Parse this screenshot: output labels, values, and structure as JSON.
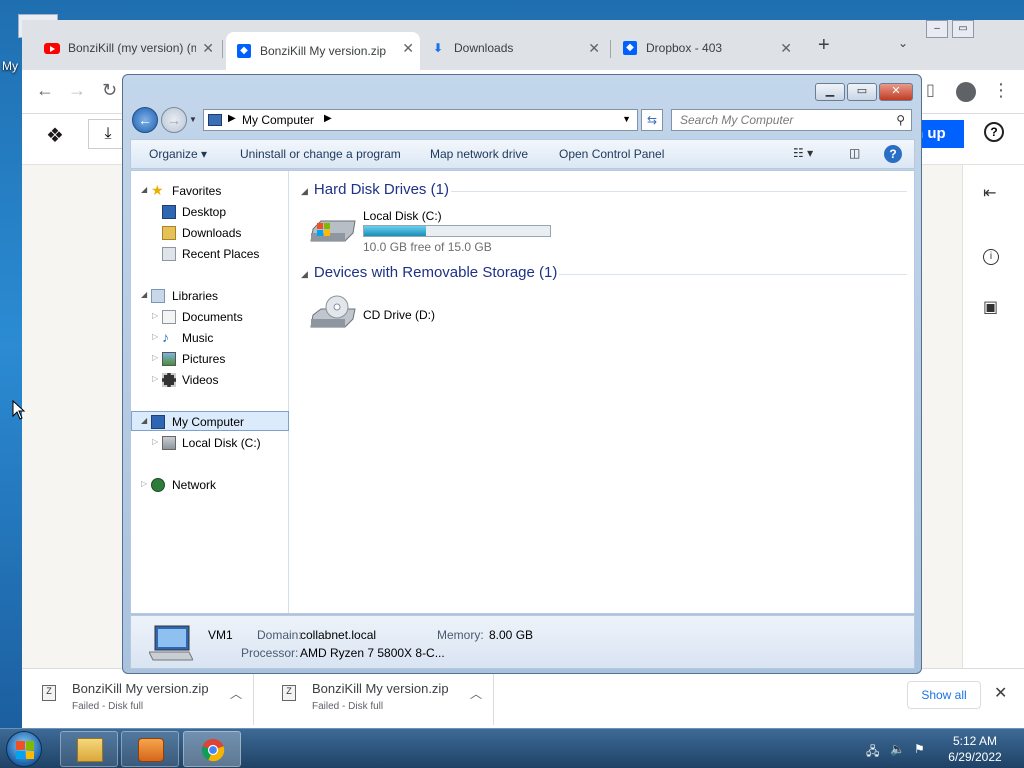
{
  "desktop": {
    "icon_label": "My"
  },
  "browser": {
    "tabs": [
      {
        "title": "BonziKill (my version) (m",
        "icon": "youtube-icon"
      },
      {
        "title": "BonziKill My version.zip",
        "icon": "dropbox-icon"
      },
      {
        "title": "Downloads",
        "icon": "download-icon"
      },
      {
        "title": "Dropbox - 403",
        "icon": "dropbox-icon"
      }
    ],
    "close_glyph": "✕",
    "new_tab_glyph": "+",
    "page": {
      "signup_label": "n up",
      "help_glyph": "?"
    },
    "downloads": [
      {
        "name": "BonziKill My version.zip",
        "status": "Failed - Disk full"
      },
      {
        "name": "BonziKill My version.zip",
        "status": "Failed - Disk full"
      }
    ],
    "show_all_label": "Show all"
  },
  "explorer": {
    "breadcrumb": "My Computer",
    "search_placeholder": "Search My Computer",
    "commands": {
      "organize": "Organize",
      "uninstall": "Uninstall or change a program",
      "map_drive": "Map network drive",
      "control_panel": "Open Control Panel"
    },
    "nav": {
      "favorites": "Favorites",
      "desktop": "Desktop",
      "downloads": "Downloads",
      "recent": "Recent Places",
      "libraries": "Libraries",
      "documents": "Documents",
      "music": "Music",
      "pictures": "Pictures",
      "videos": "Videos",
      "my_computer": "My Computer",
      "local_disk": "Local Disk (C:)",
      "network": "Network"
    },
    "groups": {
      "hdd": "Hard Disk Drives (1)",
      "removable": "Devices with Removable Storage (1)"
    },
    "drives": {
      "c_name": "Local Disk (C:)",
      "c_free": "10.0 GB free of 15.0 GB",
      "c_used_fraction": 0.3333,
      "d_name": "CD Drive (D:)"
    },
    "details": {
      "name": "VM1",
      "domain_label": "Domain:",
      "domain_value": "collabnet.local",
      "memory_label": "Memory:",
      "memory_value": "8.00 GB",
      "processor_label": "Processor:",
      "processor_value": "AMD Ryzen 7 5800X 8-C..."
    }
  },
  "taskbar": {
    "clock_time": "5:12 AM",
    "clock_date": "6/29/2022"
  },
  "colors": {
    "accent": "#0061fe",
    "explorer_frame": "#a9c2de",
    "taskbar": "#1f4266"
  }
}
